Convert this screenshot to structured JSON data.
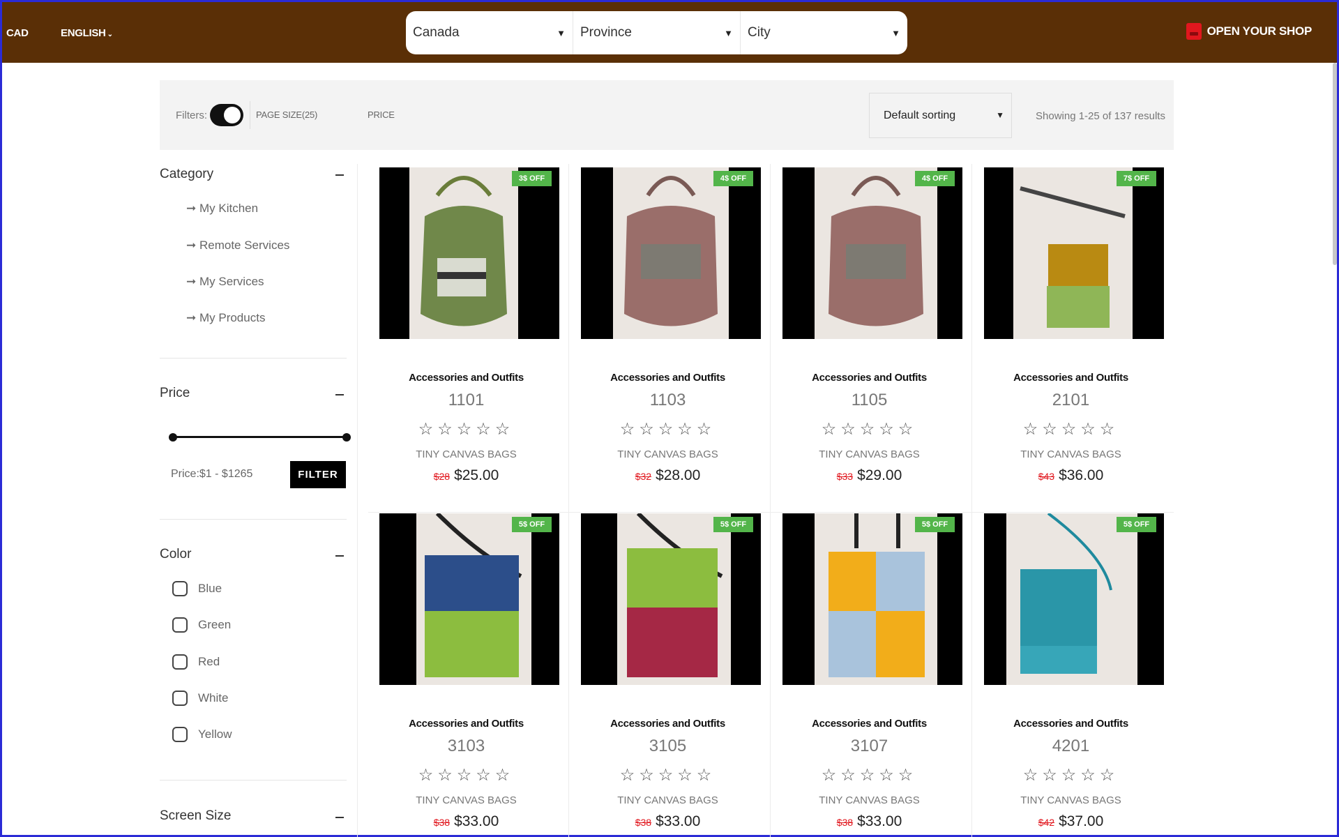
{
  "header": {
    "currency": "CAD",
    "language": "ENGLISH",
    "country": "Canada",
    "province": "Province",
    "city": "City",
    "open_shop": "OPEN YOUR SHOP",
    "bg_color": "#5a2f06"
  },
  "filterbar": {
    "filters_label": "Filters:",
    "page_size": "PAGE SIZE(25)",
    "price": "PRICE",
    "sorting": "Default sorting",
    "showing": "Showing 1-25 of 137 results"
  },
  "sidebar": {
    "category_title": "Category",
    "categories": [
      "➞ My Kitchen",
      "➞ Remote Services",
      "➞ My Services",
      "➞ My Products"
    ],
    "price_title": "Price",
    "price_range": "Price:$1 - $1265",
    "filter_button": "FILTER",
    "color_title": "Color",
    "colors": [
      "Blue",
      "Green",
      "Red",
      "White",
      "Yellow"
    ],
    "screen_size_title": "Screen Size"
  },
  "products": [
    {
      "badge": "3$ OFF",
      "category": "Accessories and Outfits",
      "name": "1101",
      "stars": "☆☆☆☆☆",
      "subtitle": "TINY CANVAS BAGS",
      "old_price": "$28",
      "price": "$25.00"
    },
    {
      "badge": "4$ OFF",
      "category": "Accessories and Outfits",
      "name": "1103",
      "stars": "☆☆☆☆☆",
      "subtitle": "TINY CANVAS BAGS",
      "old_price": "$32",
      "price": "$28.00"
    },
    {
      "badge": "4$ OFF",
      "category": "Accessories and Outfits",
      "name": "1105",
      "stars": "☆☆☆☆☆",
      "subtitle": "TINY CANVAS BAGS",
      "old_price": "$33",
      "price": "$29.00"
    },
    {
      "badge": "7$ OFF",
      "category": "Accessories and Outfits",
      "name": "2101",
      "stars": "☆☆☆☆☆",
      "subtitle": "TINY CANVAS BAGS",
      "old_price": "$43",
      "price": "$36.00"
    },
    {
      "badge": "5$ OFF",
      "category": "Accessories and Outfits",
      "name": "3103",
      "stars": "☆☆☆☆☆",
      "subtitle": "TINY CANVAS BAGS",
      "old_price": "$38",
      "price": "$33.00"
    },
    {
      "badge": "5$ OFF",
      "category": "Accessories and Outfits",
      "name": "3105",
      "stars": "☆☆☆☆☆",
      "subtitle": "TINY CANVAS BAGS",
      "old_price": "$38",
      "price": "$33.00"
    },
    {
      "badge": "5$ OFF",
      "category": "Accessories and Outfits",
      "name": "3107",
      "stars": "☆☆☆☆☆",
      "subtitle": "TINY CANVAS BAGS",
      "old_price": "$38",
      "price": "$33.00"
    },
    {
      "badge": "5$ OFF",
      "category": "Accessories and Outfits",
      "name": "4201",
      "stars": "☆☆☆☆☆",
      "subtitle": "TINY CANVAS BAGS",
      "old_price": "$42",
      "price": "$37.00"
    }
  ],
  "colors": {
    "badge": "#53b54a",
    "old_price": "#e1171e",
    "shop_icon": "#e1171e"
  }
}
